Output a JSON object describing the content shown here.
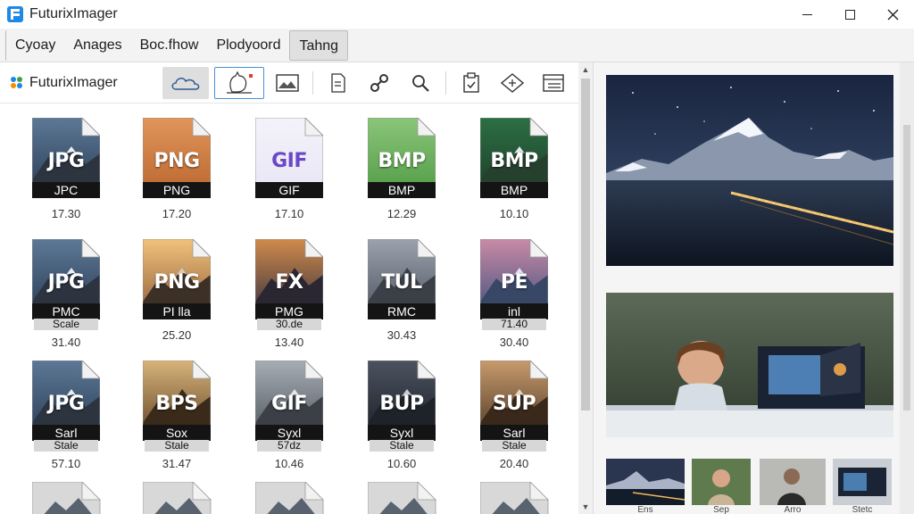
{
  "window": {
    "title": "FuturixImager",
    "controls": [
      "minimize",
      "maximize",
      "close"
    ]
  },
  "menu": {
    "items": [
      "Cyoay",
      "Anages",
      "Boc.fhow",
      "Plodyoord",
      "Tahng"
    ],
    "active_index": 4
  },
  "toolbar": {
    "brand": "FuturixImager",
    "tools": [
      "cloud-icon",
      "cat-sketch-icon",
      "image-icon",
      "document-icon",
      "link-icon",
      "search-icon",
      "clipboard-icon",
      "diamond-icon",
      "layout-icon"
    ]
  },
  "files": [
    {
      "main": "JPG",
      "sub": "JPC",
      "sub2": "",
      "size": "17.30",
      "style": "mountain"
    },
    {
      "main": "PNG",
      "sub": "PNG",
      "sub2": "",
      "size": "17.20",
      "style": "orange"
    },
    {
      "main": "GIF",
      "sub": "GIF",
      "sub2": "",
      "size": "17.10",
      "style": "lavender"
    },
    {
      "main": "BMP",
      "sub": "BMP",
      "sub2": "",
      "size": "12.29",
      "style": "green"
    },
    {
      "main": "BMP",
      "sub": "BMP",
      "sub2": "",
      "size": "10.10",
      "style": "lake"
    },
    {
      "main": "JPG",
      "sub": "PMC",
      "sub2": "Scale",
      "size": "31.40",
      "style": "mountain"
    },
    {
      "main": "PNG",
      "sub": "PI lla",
      "sub2": "",
      "size": "25.20",
      "style": "sunset"
    },
    {
      "main": "FX",
      "sub": "PMG",
      "sub2": "30.de",
      "size": "13.40",
      "style": "city"
    },
    {
      "main": "TUL",
      "sub": "RMC",
      "sub2": "",
      "size": "30.43",
      "style": "towers"
    },
    {
      "main": "PE",
      "sub": "inl",
      "sub2": "71.40",
      "size": "30.40",
      "style": "pinklake"
    },
    {
      "main": "JPG",
      "sub": "Sarl",
      "sub2": "Stale",
      "size": "57.10",
      "style": "mountain"
    },
    {
      "main": "BPS",
      "sub": "Sox",
      "sub2": "Stale",
      "size": "31.47",
      "style": "desert"
    },
    {
      "main": "GIF",
      "sub": "Syxl",
      "sub2": "57dz",
      "size": "10.46",
      "style": "graymtn"
    },
    {
      "main": "BUP",
      "sub": "Syxl",
      "sub2": "Stale",
      "size": "10.60",
      "style": "dark"
    },
    {
      "main": "SUP",
      "sub": "Sarl",
      "sub2": "Stale",
      "size": "20.40",
      "style": "brown"
    }
  ],
  "thumbnails": [
    {
      "caption": "Ens"
    },
    {
      "caption": "Sep"
    },
    {
      "caption": "Arro"
    },
    {
      "caption": "Stetc"
    }
  ],
  "colors": {
    "accent": "#1e88e5",
    "selected_border": "#4a90d9"
  }
}
